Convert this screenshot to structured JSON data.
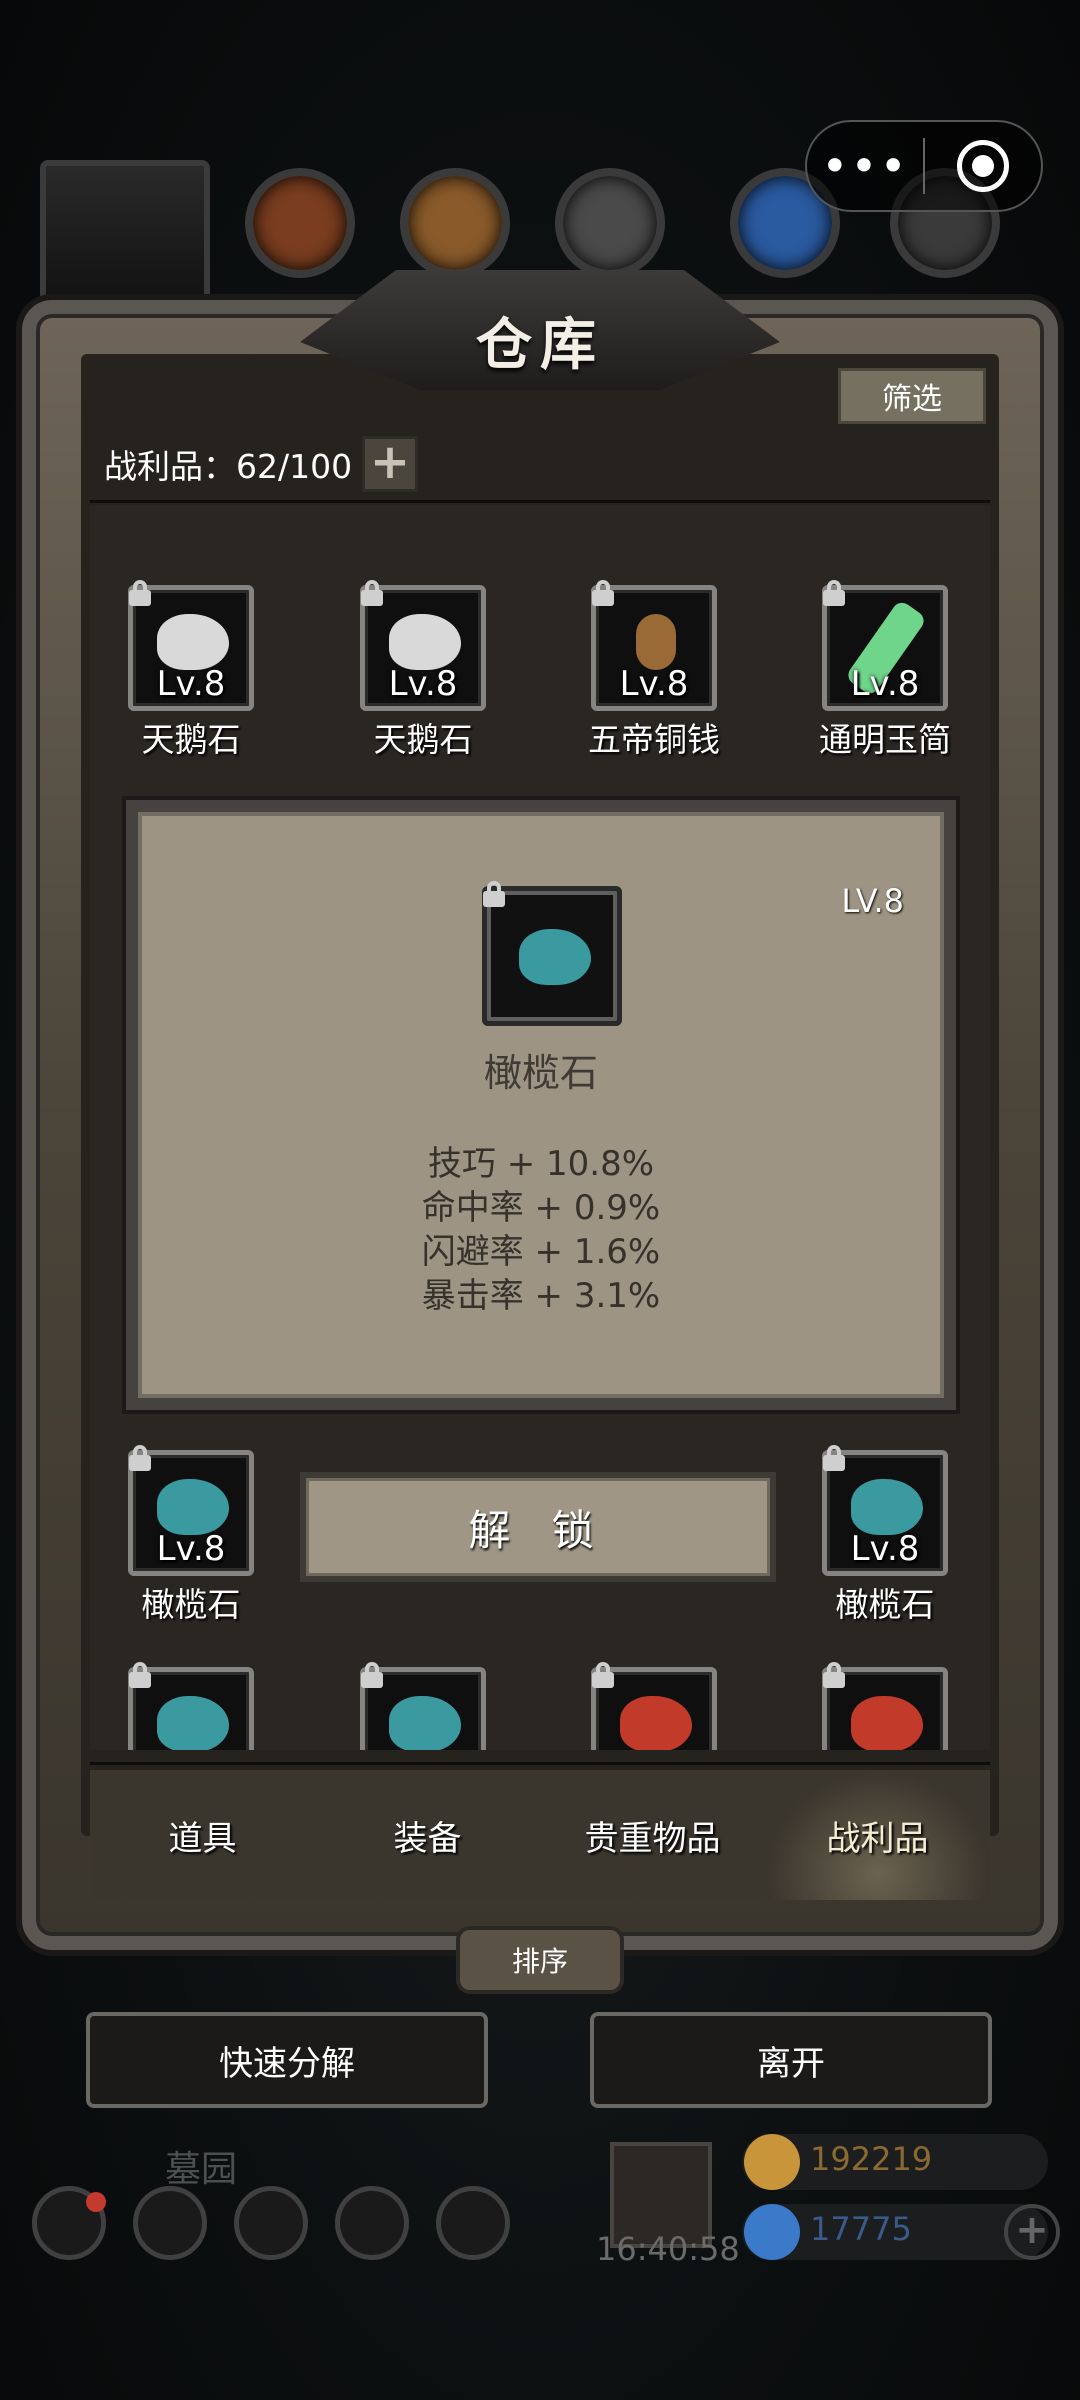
{
  "capsule": {
    "menu_glyph": "•••",
    "icons": [
      "more-dots-icon",
      "target-icon"
    ]
  },
  "resources": [
    {
      "name": "ore-red-icon",
      "color": "#7a3d1f"
    },
    {
      "name": "wood-icon",
      "color": "#8a5a2a"
    },
    {
      "name": "iron-icon",
      "color": "#4a4a4a"
    },
    {
      "name": "crystal-icon",
      "color": "#2a5aa0"
    },
    {
      "name": "steel-icon",
      "color": "#3a3a3a"
    }
  ],
  "window": {
    "title": "仓库",
    "filter_label": "筛选",
    "loot_count": "战利品：62/100",
    "plus_glyph": "+"
  },
  "items_row1": [
    {
      "name": "天鹅石",
      "lv": "Lv.8",
      "color": "#d9d9d9"
    },
    {
      "name": "天鹅石",
      "lv": "Lv.8",
      "color": "#d9d9d9"
    },
    {
      "name": "五帝铜钱",
      "lv": "Lv.8",
      "color": "#9a6a36"
    },
    {
      "name": "通明玉简",
      "lv": "Lv.8",
      "color": "#6fd58a"
    }
  ],
  "items_row2": [
    {
      "name": "橄榄石",
      "lv": "Lv.8",
      "color": "#3a9aa0"
    },
    {
      "name": "橄榄石",
      "lv": "Lv.8",
      "color": "#3a9aa0"
    }
  ],
  "items_row3": [
    {
      "color": "#3a9aa0"
    },
    {
      "color": "#3a9aa0"
    },
    {
      "color": "#c23a2a"
    },
    {
      "color": "#c23a2a"
    }
  ],
  "popup": {
    "level": "LV.8",
    "item_name": "橄榄石",
    "gem_color": "#3a9aa0",
    "stats": [
      "技巧 + 10.8%",
      "命中率 + 0.9%",
      "闪避率 + 1.6%",
      "暴击率 + 3.1%"
    ],
    "unlock_label": "解 锁"
  },
  "tabs": [
    {
      "label": "道具",
      "active": false
    },
    {
      "label": "装备",
      "active": false
    },
    {
      "label": "贵重物品",
      "active": false
    },
    {
      "label": "战利品",
      "active": true
    }
  ],
  "sort_label": "排序",
  "actions": {
    "decompose_label": "快速分解",
    "leave_label": "离开"
  },
  "hud": {
    "location": "墓园",
    "timer": "16:40:58",
    "gold": "192219",
    "gems": "17775",
    "gold_color": "#c9953a",
    "gem_color": "#3a7ac9"
  }
}
